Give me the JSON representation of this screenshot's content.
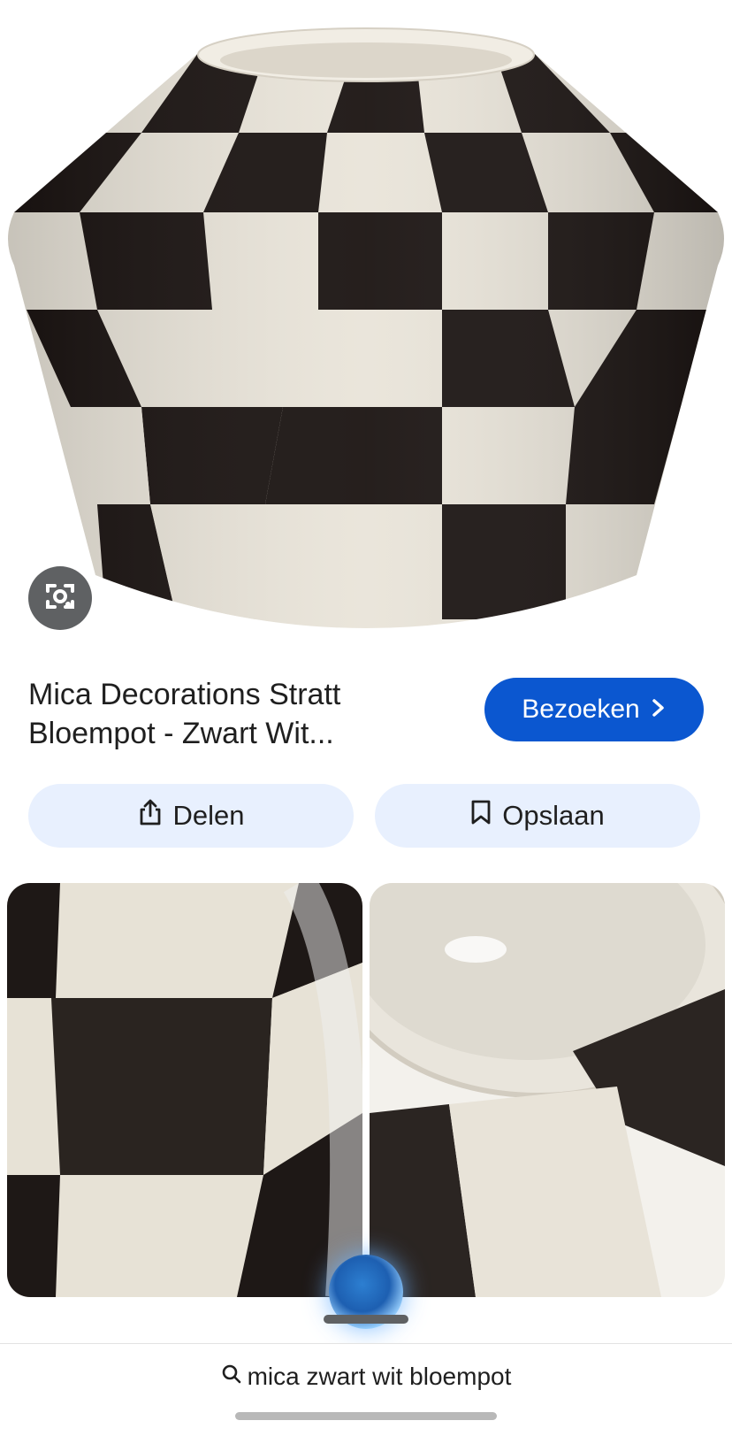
{
  "result": {
    "title": "Mica Decorations Stratt Bloempot - Zwart Wit...",
    "visit_button": "Bezoeken",
    "share_button": "Delen",
    "save_button": "Opslaan"
  },
  "icons": {
    "lens": "google-lens-icon",
    "chevron": "chevron-right-icon",
    "share": "share-icon",
    "bookmark": "bookmark-icon",
    "search": "search-icon"
  },
  "search": {
    "query": "mica zwart wit bloempot"
  },
  "colors": {
    "accent": "#0b57d0",
    "pill_bg": "#e8f0fe",
    "lens_bg": "#5f6163"
  }
}
